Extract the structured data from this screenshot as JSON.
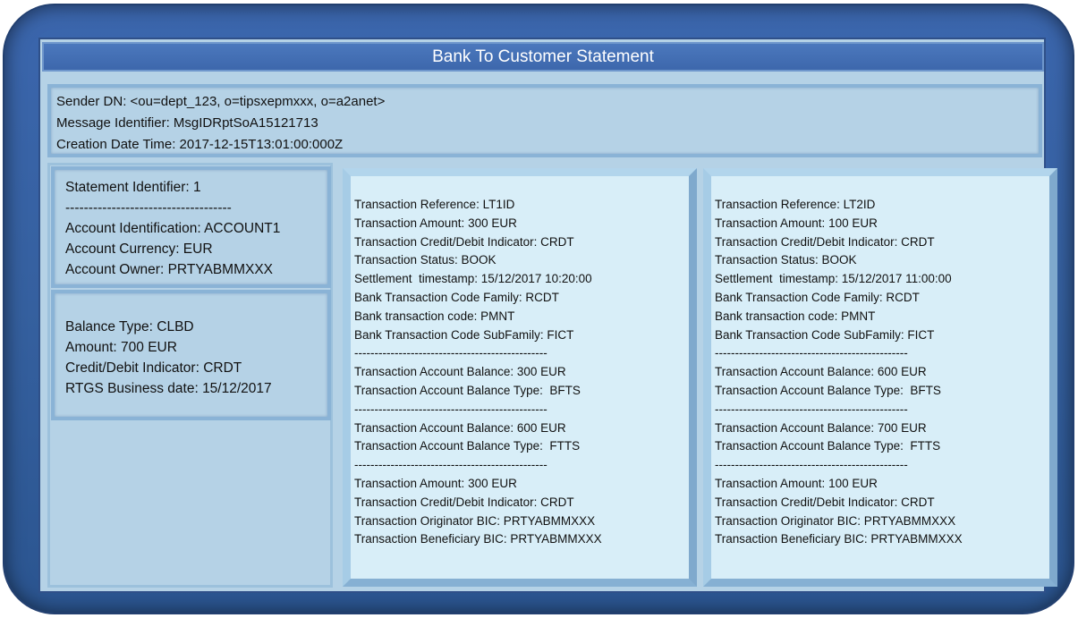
{
  "title": "Bank To Customer Statement",
  "header": {
    "sender_dn": "Sender DN: <ou=dept_123, o=tipsxepmxxx, o=a2anet>",
    "message_identifier": "Message Identifier: MsgIDRptSoA15121713",
    "creation_date_time": "Creation Date Time: 2017-12-15T13:01:00:000Z"
  },
  "statement": {
    "identifier": "Statement Identifier: 1",
    "separator": "------------------------------------",
    "account_identification": "Account Identification: ACCOUNT1",
    "account_currency": "Account Currency: EUR",
    "account_owner": "Account Owner: PRTYABMMXXX"
  },
  "balance": {
    "type": "Balance Type: CLBD",
    "amount": "Amount: 700 EUR",
    "credit_debit": "Credit/Debit Indicator: CRDT",
    "business_date": "RTGS Business date: 15/12/2017"
  },
  "transactions": [
    {
      "lines": [
        "Transaction Reference: LT1ID",
        "Transaction Amount: 300 EUR",
        "Transaction Credit/Debit Indicator: CRDT",
        "Transaction Status: BOOK",
        "Settlement  timestamp: 15/12/2017 10:20:00",
        "Bank Transaction Code Family: RCDT",
        "Bank transaction code: PMNT",
        "Bank Transaction Code SubFamily: FICT",
        "------------------------------------------------",
        "Transaction Account Balance: 300 EUR",
        "Transaction Account Balance Type:  BFTS",
        "------------------------------------------------",
        "Transaction Account Balance: 600 EUR",
        "Transaction Account Balance Type:  FTTS",
        "------------------------------------------------",
        "Transaction Amount: 300 EUR",
        "Transaction Credit/Debit Indicator: CRDT",
        "Transaction Originator BIC: PRTYABMMXXX",
        "Transaction Beneficiary BIC: PRTYABMMXXX"
      ]
    },
    {
      "lines": [
        "Transaction Reference: LT2ID",
        "Transaction Amount: 100 EUR",
        "Transaction Credit/Debit Indicator: CRDT",
        "Transaction Status: BOOK",
        "Settlement  timestamp: 15/12/2017 11:00:00",
        "Bank Transaction Code Family: RCDT",
        "Bank transaction code: PMNT",
        "Bank Transaction Code SubFamily: FICT",
        "------------------------------------------------",
        "Transaction Account Balance: 600 EUR",
        "Transaction Account Balance Type:  BFTS",
        "------------------------------------------------",
        "Transaction Account Balance: 700 EUR",
        "Transaction Account Balance Type:  FTTS",
        "------------------------------------------------",
        "Transaction Amount: 100 EUR",
        "Transaction Credit/Debit Indicator: CRDT",
        "Transaction Originator BIC: PRTYABMMXXX",
        "Transaction Beneficiary BIC: PRTYABMMXXX"
      ]
    }
  ]
}
